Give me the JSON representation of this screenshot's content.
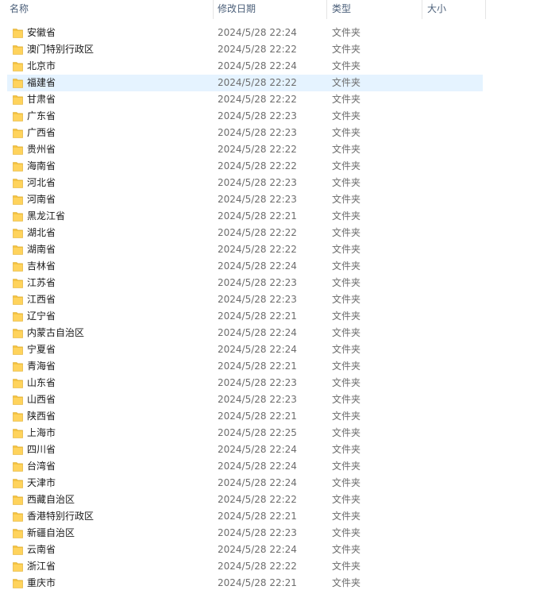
{
  "header": {
    "col_name": "名称",
    "col_date": "修改日期",
    "col_type": "类型",
    "col_size": "大小",
    "sort_caret": "^"
  },
  "icons": {
    "folder": "folder-icon",
    "folder_color": "#f5c342"
  },
  "selection_color": "#e5f3ff",
  "files": [
    {
      "name": "安徽省",
      "date": "2024/5/28 22:24",
      "type": "文件夹"
    },
    {
      "name": "澳门特别行政区",
      "date": "2024/5/28 22:22",
      "type": "文件夹"
    },
    {
      "name": "北京市",
      "date": "2024/5/28 22:24",
      "type": "文件夹"
    },
    {
      "name": "福建省",
      "date": "2024/5/28 22:22",
      "type": "文件夹",
      "selected": true
    },
    {
      "name": "甘肃省",
      "date": "2024/5/28 22:22",
      "type": "文件夹"
    },
    {
      "name": "广东省",
      "date": "2024/5/28 22:23",
      "type": "文件夹"
    },
    {
      "name": "广西省",
      "date": "2024/5/28 22:23",
      "type": "文件夹"
    },
    {
      "name": "贵州省",
      "date": "2024/5/28 22:22",
      "type": "文件夹"
    },
    {
      "name": "海南省",
      "date": "2024/5/28 22:22",
      "type": "文件夹"
    },
    {
      "name": "河北省",
      "date": "2024/5/28 22:23",
      "type": "文件夹"
    },
    {
      "name": "河南省",
      "date": "2024/5/28 22:23",
      "type": "文件夹"
    },
    {
      "name": "黑龙江省",
      "date": "2024/5/28 22:21",
      "type": "文件夹"
    },
    {
      "name": "湖北省",
      "date": "2024/5/28 22:22",
      "type": "文件夹"
    },
    {
      "name": "湖南省",
      "date": "2024/5/28 22:22",
      "type": "文件夹"
    },
    {
      "name": "吉林省",
      "date": "2024/5/28 22:24",
      "type": "文件夹"
    },
    {
      "name": "江苏省",
      "date": "2024/5/28 22:23",
      "type": "文件夹"
    },
    {
      "name": "江西省",
      "date": "2024/5/28 22:23",
      "type": "文件夹"
    },
    {
      "name": "辽宁省",
      "date": "2024/5/28 22:21",
      "type": "文件夹"
    },
    {
      "name": "内蒙古自治区",
      "date": "2024/5/28 22:24",
      "type": "文件夹"
    },
    {
      "name": "宁夏省",
      "date": "2024/5/28 22:24",
      "type": "文件夹"
    },
    {
      "name": "青海省",
      "date": "2024/5/28 22:21",
      "type": "文件夹"
    },
    {
      "name": "山东省",
      "date": "2024/5/28 22:23",
      "type": "文件夹"
    },
    {
      "name": "山西省",
      "date": "2024/5/28 22:23",
      "type": "文件夹"
    },
    {
      "name": "陕西省",
      "date": "2024/5/28 22:21",
      "type": "文件夹"
    },
    {
      "name": "上海市",
      "date": "2024/5/28 22:25",
      "type": "文件夹"
    },
    {
      "name": "四川省",
      "date": "2024/5/28 22:24",
      "type": "文件夹"
    },
    {
      "name": "台湾省",
      "date": "2024/5/28 22:24",
      "type": "文件夹"
    },
    {
      "name": "天津市",
      "date": "2024/5/28 22:24",
      "type": "文件夹"
    },
    {
      "name": "西藏自治区",
      "date": "2024/5/28 22:22",
      "type": "文件夹"
    },
    {
      "name": "香港特别行政区",
      "date": "2024/5/28 22:21",
      "type": "文件夹"
    },
    {
      "name": "新疆自治区",
      "date": "2024/5/28 22:23",
      "type": "文件夹"
    },
    {
      "name": "云南省",
      "date": "2024/5/28 22:24",
      "type": "文件夹"
    },
    {
      "name": "浙江省",
      "date": "2024/5/28 22:22",
      "type": "文件夹"
    },
    {
      "name": "重庆市",
      "date": "2024/5/28 22:21",
      "type": "文件夹"
    }
  ]
}
